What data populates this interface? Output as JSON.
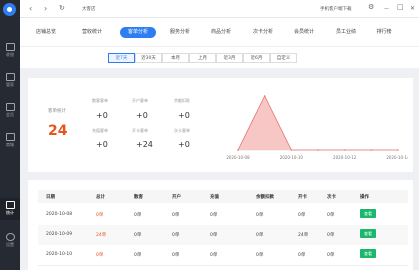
{
  "window": {
    "title": "大客店",
    "download_label": "手机客户端下载",
    "back": "‹",
    "forward": "›",
    "refresh": "↻",
    "settings": "⚙",
    "minimize": "—",
    "maximize": "□",
    "close": "✕"
  },
  "sidebar": {
    "items": [
      {
        "label": "收银",
        "icon": "cash-register-icon"
      },
      {
        "label": "管家",
        "icon": "manager-icon"
      },
      {
        "label": "会员",
        "icon": "member-icon"
      },
      {
        "label": "商城",
        "icon": "shop-icon"
      },
      {
        "label": "统计",
        "icon": "statistics-icon"
      },
      {
        "label": "设置",
        "icon": "settings-icon"
      }
    ]
  },
  "tabs": [
    "店铺总览",
    "营收统计",
    "客单分析",
    "服务分析",
    "商品分析",
    "次卡分析",
    "会员统计",
    "员工业绩",
    "排行榜"
  ],
  "active_tab": "客单分析",
  "periods": [
    "近7天",
    "近30天",
    "本月",
    "上月",
    "近3月",
    "近6月",
    "自定义"
  ],
  "active_period": "近7天",
  "summary": {
    "total_label": "客单统计",
    "total_value": "24",
    "cells": [
      {
        "label": "散客客单",
        "value": "+0"
      },
      {
        "label": "开户客单",
        "value": "+0"
      },
      {
        "label": "余额扣款",
        "value": "+0"
      },
      {
        "label": "充值客单",
        "value": "+0"
      },
      {
        "label": "开卡客单",
        "value": "+24"
      },
      {
        "label": "次卡客单",
        "value": "+0"
      }
    ]
  },
  "chart_data": {
    "type": "area",
    "x": [
      "2020-10-08",
      "2020-10-09",
      "2020-10-10",
      "2020-10-11",
      "2020-10-12",
      "2020-10-13",
      "2020-10-14"
    ],
    "xticks": [
      "2020-10-08",
      "2020-10-10",
      "2020-10-12",
      "2020-10-14"
    ],
    "values": [
      0,
      24,
      0,
      0,
      0,
      0,
      0
    ],
    "ylim": [
      0,
      24
    ],
    "color": "#e8736f",
    "fill": "#f6c7c5"
  },
  "table": {
    "headers": [
      "日期",
      "总计",
      "散客",
      "开户",
      "充值",
      "余额扣款",
      "开卡",
      "次卡",
      "操作"
    ],
    "action_label": "查看",
    "rows": [
      [
        "2020-10-08",
        "0单",
        "0单",
        "0单",
        "0单",
        "0单",
        "0单",
        "0单"
      ],
      [
        "2020-10-09",
        "24单",
        "0单",
        "0单",
        "0单",
        "0单",
        "24单",
        "0单"
      ],
      [
        "2020-10-10",
        "0单",
        "0单",
        "0单",
        "0单",
        "0单",
        "0单",
        "0单"
      ]
    ]
  },
  "colors": {
    "accent": "#2f7ef0",
    "highlight": "#e8541e",
    "action": "#19b86b",
    "sidebar": "#262b33"
  }
}
